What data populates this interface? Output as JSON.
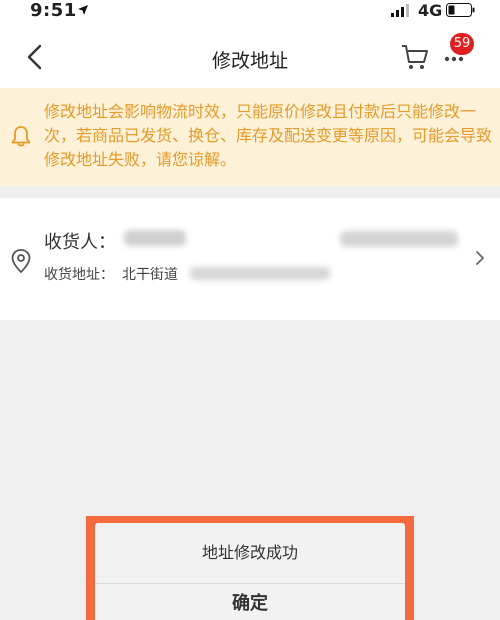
{
  "status_bar": {
    "time": "9:51",
    "network": "4G"
  },
  "nav": {
    "title": "修改地址",
    "badge_count": "59"
  },
  "notice": {
    "text": "修改地址会影响物流时效，只能原价修改且付款后只能修改一次，若商品已发货、换仓、库存及配送变更等原因，可能会导致修改地址失败，请您谅解。"
  },
  "address": {
    "recipient_label": "收货人：",
    "address_label": "收货地址：",
    "street": "北干街道"
  },
  "dialog": {
    "message": "地址修改成功",
    "confirm_label": "确定"
  },
  "colors": {
    "notice_bg": "#fdf1d8",
    "notice_text": "#e59a2a",
    "badge": "#e02020",
    "highlight_frame": "#f26a3e"
  }
}
